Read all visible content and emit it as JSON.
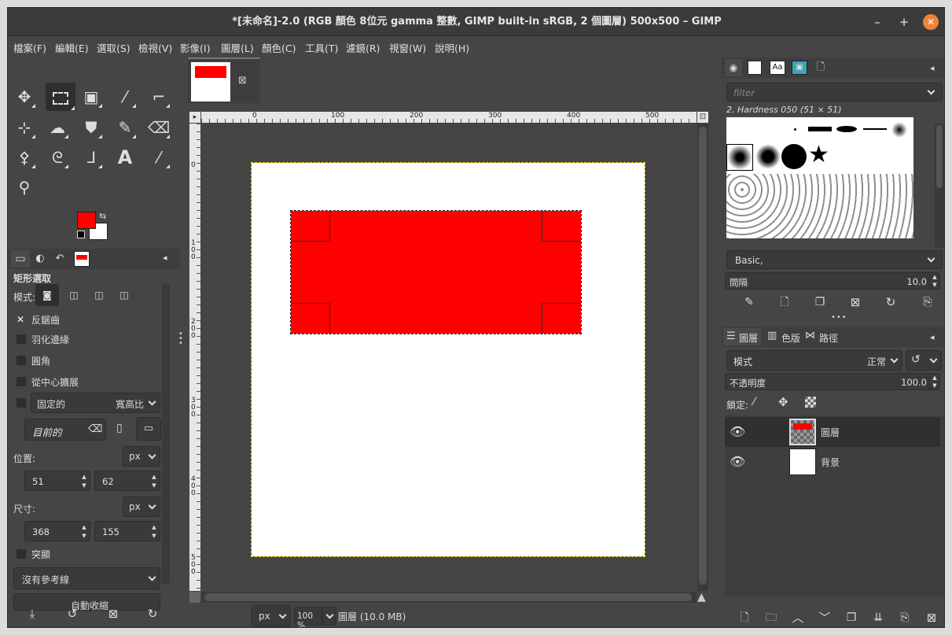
{
  "window": {
    "title": "*[未命名]-2.0 (RGB 顏色 8位元 gamma 整數, GIMP built-in sRGB, 2 個圖層) 500x500 – GIMP",
    "minimize": "–",
    "maximize": "+",
    "close": "✕"
  },
  "menus": [
    "檔案(F)",
    "編輯(E)",
    "選取(S)",
    "檢視(V)",
    "影像(I)",
    "圖層(L)",
    "顏色(C)",
    "工具(T)",
    "濾鏡(R)",
    "視窗(W)",
    "說明(H)"
  ],
  "toolbox": {
    "fg_color": "#ff0000",
    "bg_color": "#ffffff",
    "tools": [
      "move-icon",
      "rect-select-icon",
      "align-icon",
      "fuzzy-select-icon",
      "crop-icon",
      "transform-icon",
      "warp-icon",
      "bucket-fill-icon",
      "paintbrush-icon",
      "eraser-icon",
      "clone-icon",
      "lasso-icon",
      "paths-icon",
      "text-icon",
      "color-picker-icon",
      "zoom-icon"
    ]
  },
  "tool_options": {
    "title": "矩形選取",
    "mode_label": "模式:",
    "antialias": "反鋸齒",
    "feather": "羽化邊緣",
    "rounded": "圓角",
    "expand_center": "從中心擴展",
    "fixed": "固定的",
    "fixed_value": "寬高比",
    "current": "目前的",
    "position_label": "位置:",
    "position_unit": "px",
    "pos_x": "51",
    "pos_y": "62",
    "size_label": "尺寸:",
    "size_unit": "px",
    "size_w": "368",
    "size_h": "155",
    "highlight": "突顯",
    "guides": "沒有參考線",
    "auto_shrink": "自動收縮"
  },
  "canvas": {
    "rulers_h": [
      "0",
      "100",
      "200",
      "300",
      "400",
      "500"
    ],
    "rulers_v": [
      "0",
      "100",
      "200",
      "300",
      "400",
      "500"
    ],
    "image_bg": "#ffffff",
    "selection_fill": "#ff0000",
    "unit": "px",
    "zoom": "100 %",
    "status": "圖層 (10.0 MB)"
  },
  "brushes": {
    "filter_placeholder": "filter",
    "brush_name": "2. Hardness 050 (51 × 51)",
    "preset": "Basic,",
    "spacing_label": "間隔",
    "spacing_value": "10.0"
  },
  "layers": {
    "tabs": [
      "圖層",
      "色版",
      "路徑"
    ],
    "mode_label": "模式",
    "mode_value": "正常",
    "opacity_label": "不透明度",
    "opacity_value": "100.0",
    "lock_label": "鎖定:",
    "items": [
      {
        "name": "圖層"
      },
      {
        "name": "背景"
      }
    ]
  }
}
